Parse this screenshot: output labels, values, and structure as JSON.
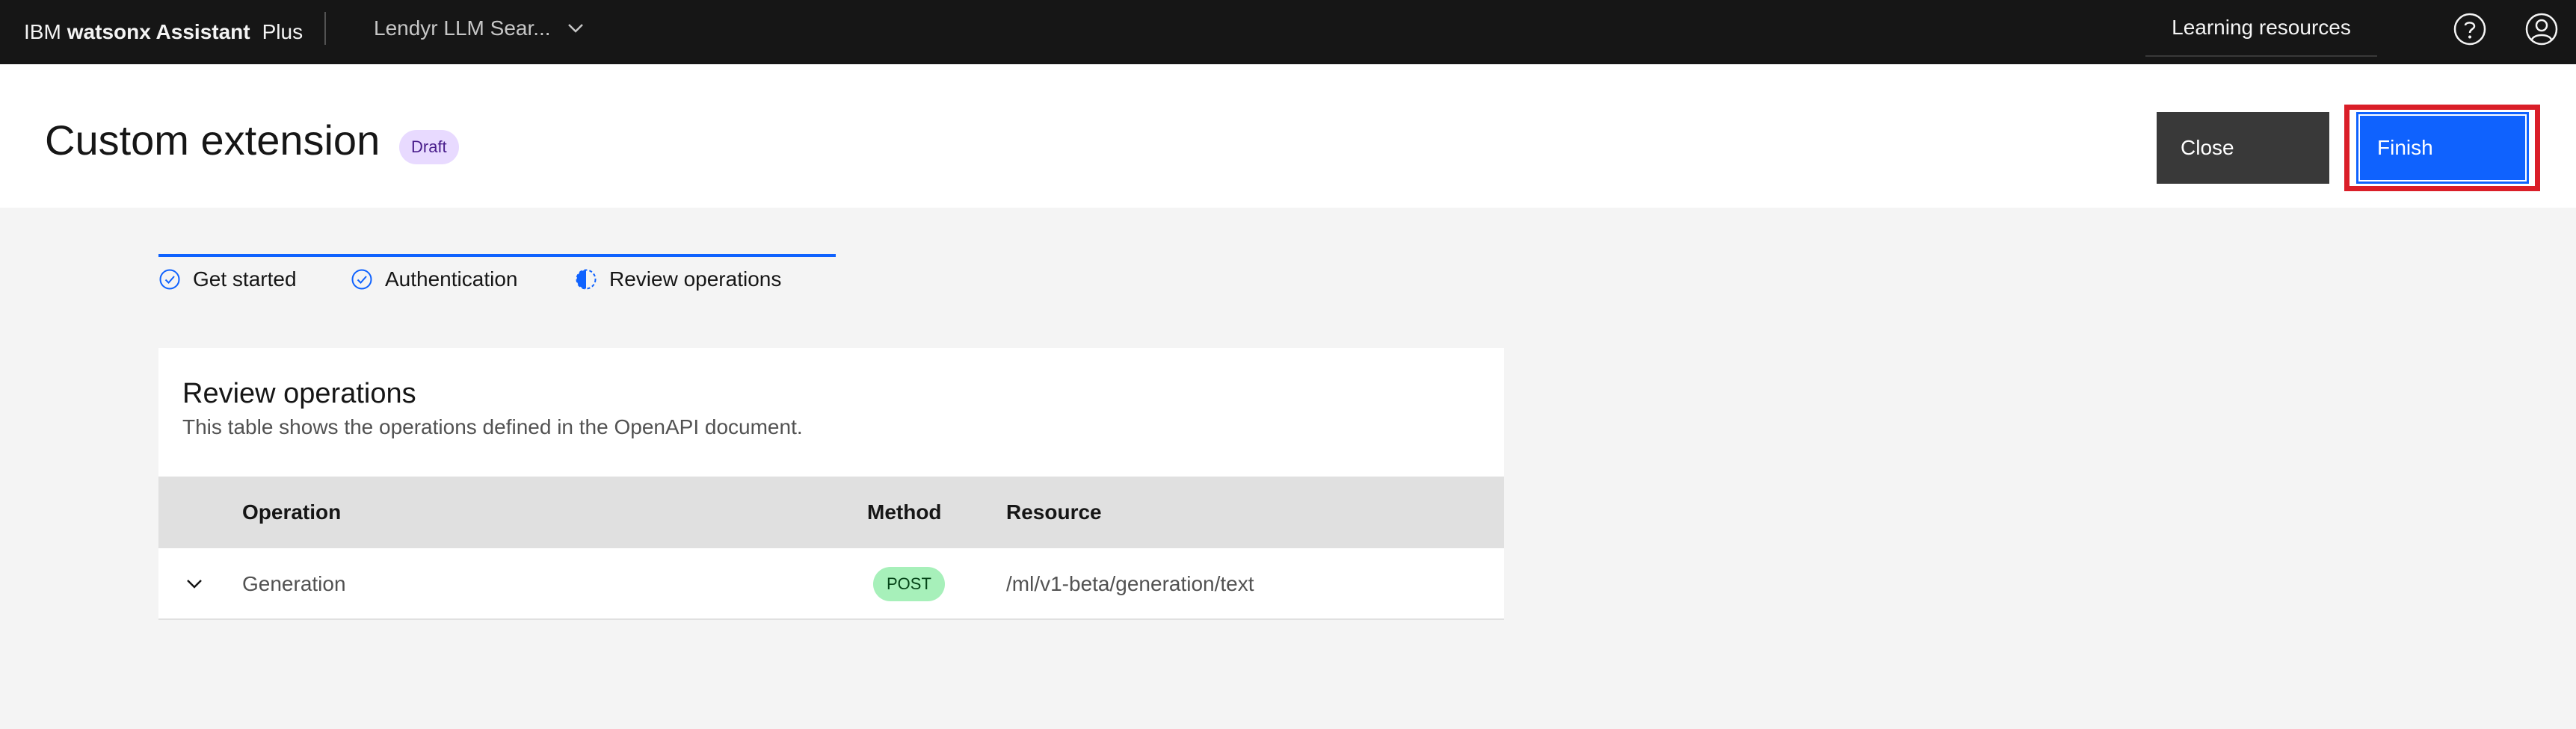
{
  "header": {
    "brand_prefix": "IBM",
    "brand_name": "watsonx Assistant",
    "brand_plan": "Plus",
    "assistant_name": "Lendyr LLM Sear...",
    "learning_resources": "Learning resources",
    "help_icon": "help-icon",
    "user_icon": "user-avatar-icon"
  },
  "page": {
    "title": "Custom extension",
    "status_tag": "Draft",
    "close_label": "Close",
    "finish_label": "Finish"
  },
  "progress": {
    "steps": [
      {
        "label": "Get started",
        "state": "complete"
      },
      {
        "label": "Authentication",
        "state": "complete"
      },
      {
        "label": "Review operations",
        "state": "current"
      }
    ]
  },
  "review": {
    "title": "Review operations",
    "description": "This table shows the operations defined in the OpenAPI document.",
    "columns": [
      "Operation",
      "Method",
      "Resource"
    ],
    "rows": [
      {
        "operation": "Generation",
        "method": "POST",
        "resource": "/ml/v1-beta/generation/text"
      }
    ]
  },
  "colors": {
    "header_bg": "#161616",
    "primary": "#0f62fe",
    "highlight_outline": "#da1e28",
    "draft_tag_bg": "#e8daff",
    "method_tag_bg": "#a7f0ba"
  }
}
